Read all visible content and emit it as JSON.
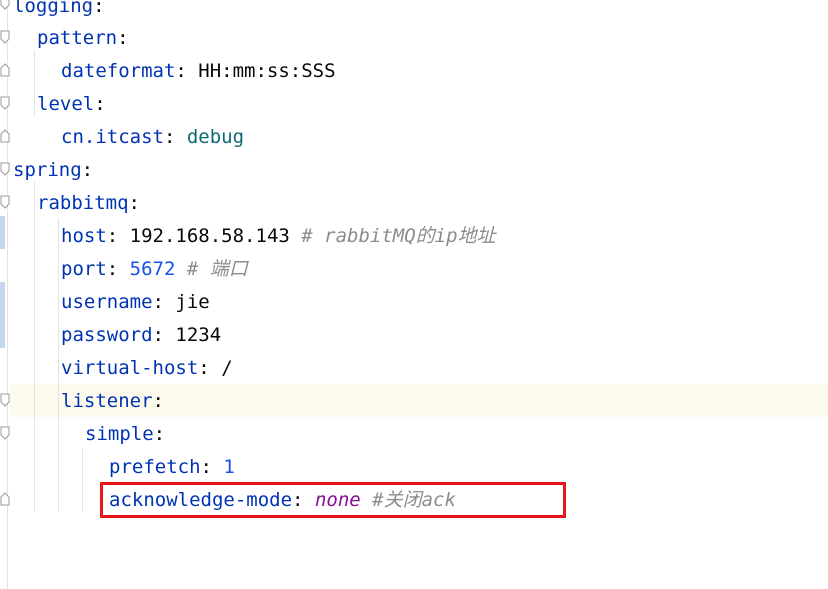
{
  "editor": {
    "lines": [
      {
        "key": "logging",
        "sep": ":",
        "value": "",
        "comment": ""
      },
      {
        "key": "pattern",
        "sep": ":",
        "value": "",
        "comment": ""
      },
      {
        "key": "dateformat",
        "sep": ":",
        "value": "HH:mm:ss:SSS",
        "comment": ""
      },
      {
        "key": "level",
        "sep": ":",
        "value": "",
        "comment": ""
      },
      {
        "key": "cn.itcast",
        "sep": ":",
        "value": "debug",
        "comment": ""
      },
      {
        "key": "spring",
        "sep": ":",
        "value": "",
        "comment": ""
      },
      {
        "key": "rabbitmq",
        "sep": ":",
        "value": "",
        "comment": ""
      },
      {
        "key": "host",
        "sep": ":",
        "value": "192.168.58.143",
        "comment": "# rabbitMQ的ip地址"
      },
      {
        "key": "port",
        "sep": ":",
        "value": "5672",
        "comment": "# 端口"
      },
      {
        "key": "username",
        "sep": ":",
        "value": "jie",
        "comment": ""
      },
      {
        "key": "password",
        "sep": ":",
        "value": "1234",
        "comment": ""
      },
      {
        "key": "virtual-host",
        "sep": ":",
        "value": "/",
        "comment": ""
      },
      {
        "key": "listener",
        "sep": ":",
        "value": "",
        "comment": ""
      },
      {
        "key": "simple",
        "sep": ":",
        "value": "",
        "comment": ""
      },
      {
        "key": "prefetch",
        "sep": ":",
        "value": "1",
        "comment": ""
      },
      {
        "key": "acknowledge-mode",
        "sep": ":",
        "value": "none",
        "comment": "#关闭ack"
      }
    ]
  },
  "colors": {
    "key": "#0033b3",
    "number": "#1750eb",
    "scalar": "#0b6a73",
    "keyword": "#871094",
    "comment": "#8c8c8c",
    "highlight_border": "#e8141b",
    "caret_line": "#fcfaed"
  }
}
